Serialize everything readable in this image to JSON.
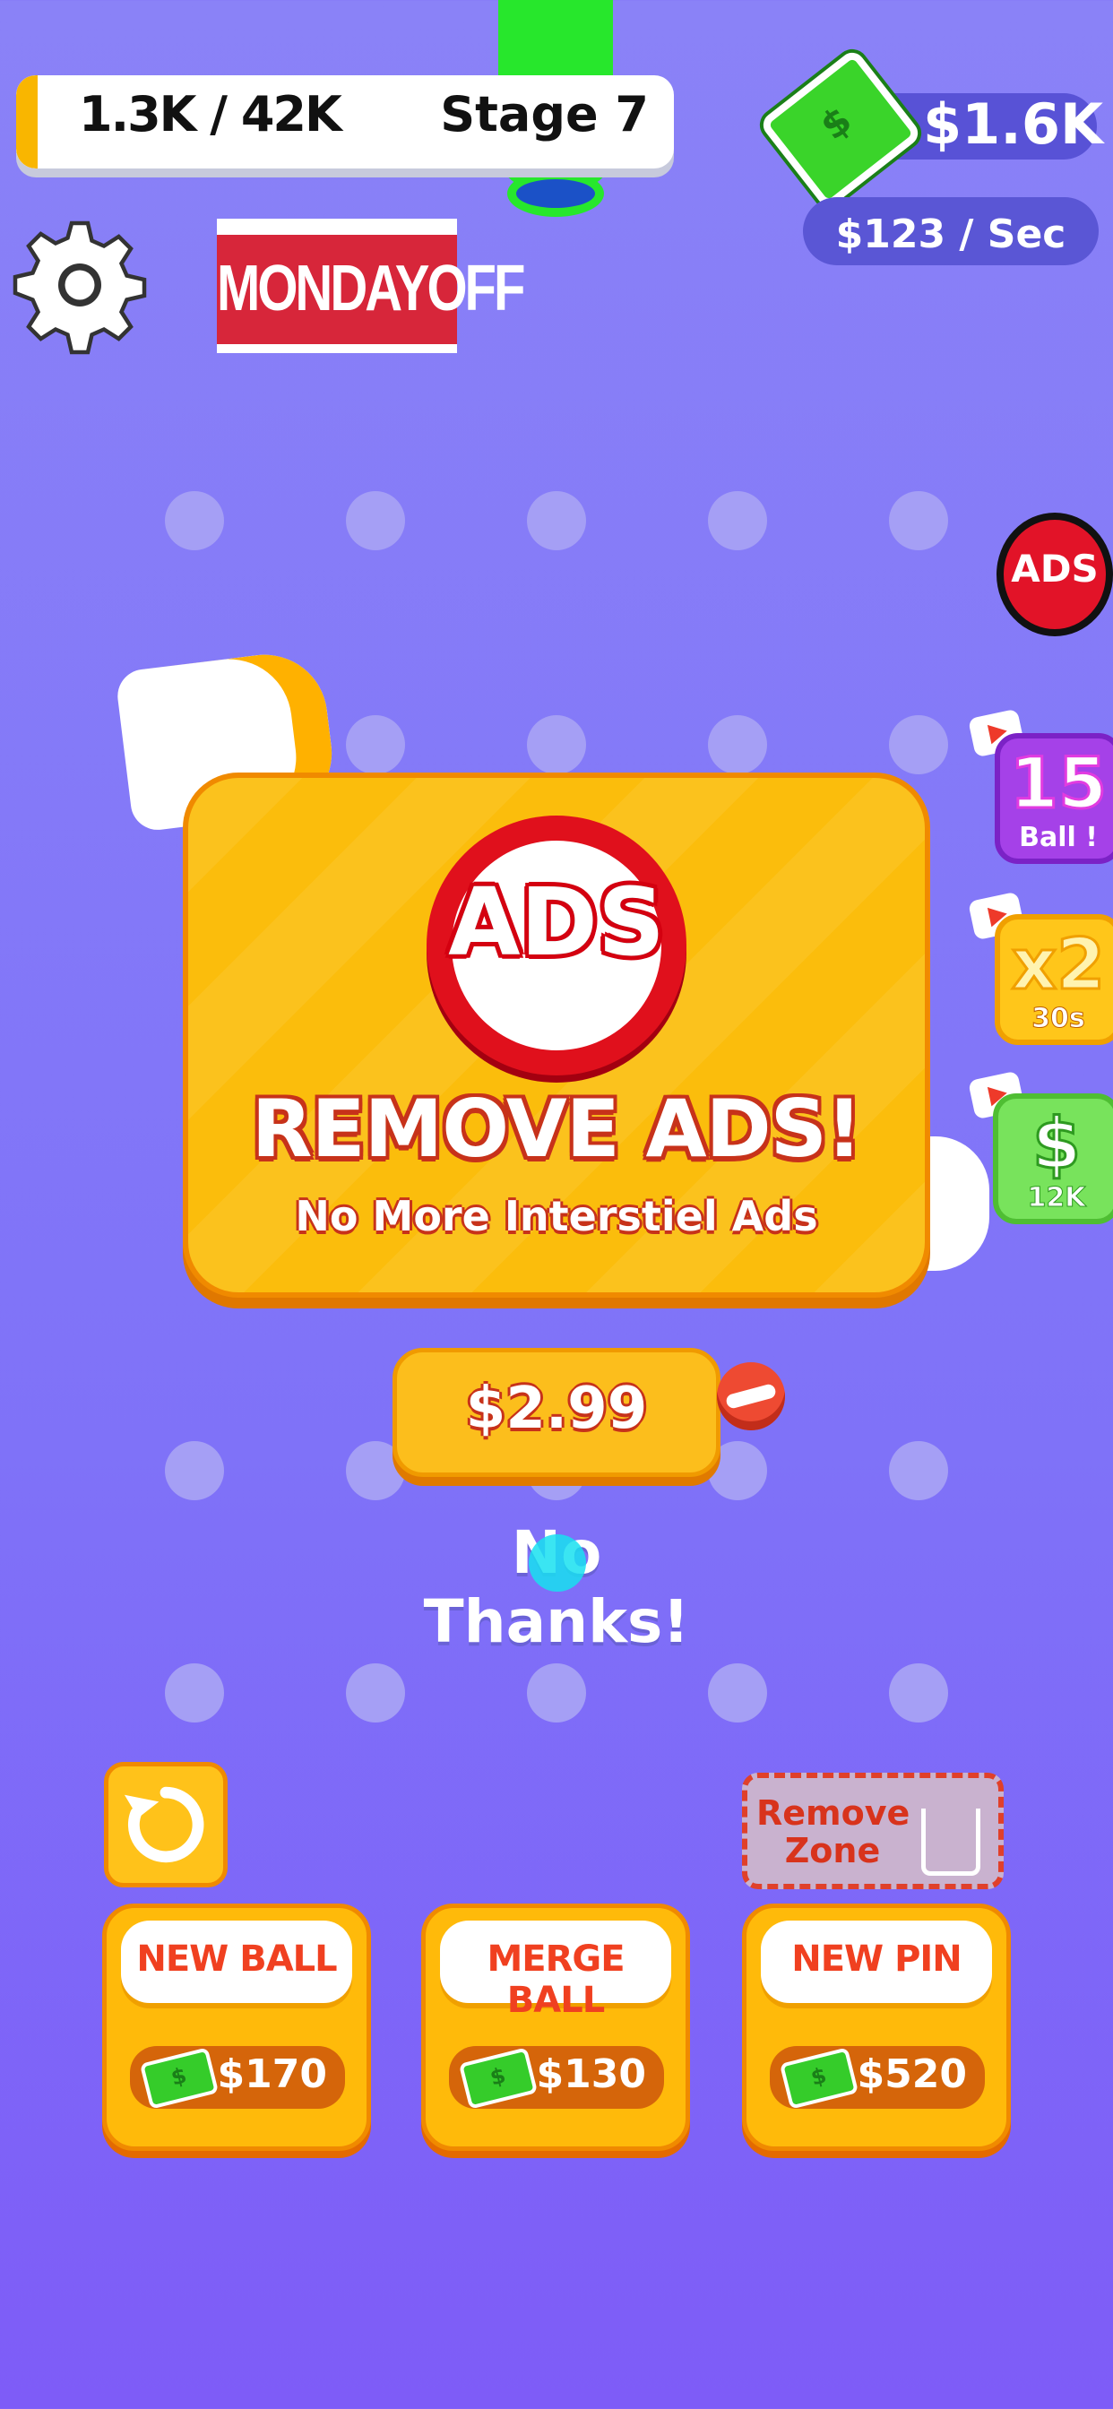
{
  "hud": {
    "progress_text": "1.3K / 42K",
    "progress_value": 0.031,
    "stage_text": "Stage 7",
    "money_text": "$1.6K",
    "rate_text": "$123 / Sec",
    "cash_symbol": "$"
  },
  "logo": {
    "text": "MONDAYOFF"
  },
  "side": {
    "no_ads_text": "ADS",
    "ball_boost": {
      "big": "15",
      "small": "Ball !"
    },
    "multiplier": {
      "big": "x2",
      "small": "30s"
    },
    "cash_boost": {
      "big": "$",
      "small": "12K"
    }
  },
  "popup": {
    "icon_text": "ADS",
    "title": "REMOVE ADS!",
    "subtitle": "No More Interstiel Ads",
    "price": "$2.99",
    "dismiss": "No Thanks!"
  },
  "bottom": {
    "remove_zone": "Remove Zone",
    "buttons": [
      {
        "label": "NEW BALL",
        "price": "$170"
      },
      {
        "label": "MERGE BALL",
        "price": "$130"
      },
      {
        "label": "NEW PIN",
        "price": "$520"
      }
    ]
  },
  "colors": {
    "background": "#8a82f7",
    "accent": "#fbbd0c",
    "danger": "#e0101c",
    "cash_green": "#3ad42a"
  },
  "icons": [
    "gear-icon",
    "cash-icon",
    "no-ads-icon",
    "play-icon",
    "refresh-icon",
    "trash-icon"
  ]
}
